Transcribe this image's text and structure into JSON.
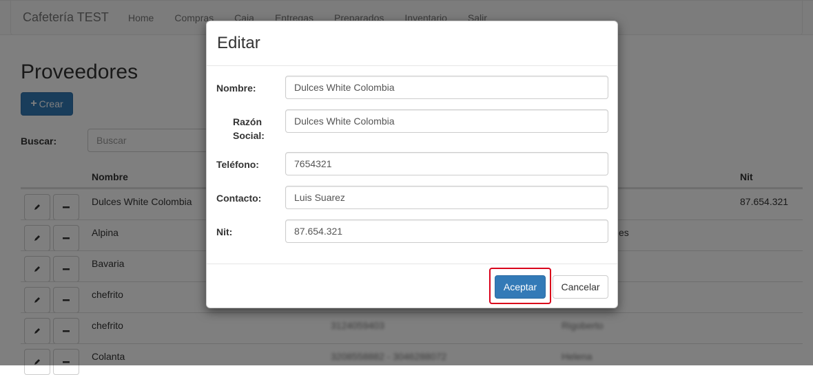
{
  "navbar": {
    "brand": "Cafetería TEST",
    "items": [
      {
        "label": "Home"
      },
      {
        "label": "Compras"
      },
      {
        "label": "Caja"
      },
      {
        "label": "Entregas"
      },
      {
        "label": "Preparados"
      },
      {
        "label": "Inventario"
      },
      {
        "label": "Salir"
      }
    ]
  },
  "page": {
    "title": "Proveedores",
    "create_button": "Crear",
    "search_label": "Buscar:",
    "search_placeholder": "Buscar"
  },
  "table": {
    "headers": {
      "nombre": "Nombre",
      "nit": "Nit"
    },
    "rows": [
      {
        "nombre": "Dulces White Colombia",
        "telefono": "",
        "contacto": "",
        "nit": "87.654.321"
      },
      {
        "nombre": "Alpina",
        "telefono": "",
        "contacto": "es",
        "nit": ""
      },
      {
        "nombre": "Bavaria",
        "telefono": "",
        "contacto": "",
        "nit": ""
      },
      {
        "nombre": "chefrito",
        "telefono": "",
        "contacto": "",
        "nit": ""
      },
      {
        "nombre": "chefrito",
        "telefono": "3124059403",
        "contacto": "Rigoberto",
        "nit": ""
      },
      {
        "nombre": "Colanta",
        "telefono": "3208558882 - 3046288072",
        "contacto": "Helena",
        "nit": ""
      }
    ]
  },
  "modal": {
    "title": "Editar",
    "fields": {
      "nombre": {
        "label": "Nombre:",
        "value": "Dulces White Colombia"
      },
      "razon_social": {
        "label_1": "Razón",
        "label_2": "Social:",
        "value": "Dulces White Colombia"
      },
      "telefono": {
        "label": "Teléfono:",
        "value": "7654321"
      },
      "contacto": {
        "label": "Contacto:",
        "value": "Luis Suarez"
      },
      "nit": {
        "label": "Nit:",
        "value": "87.654.321"
      }
    },
    "accept_button": "Aceptar",
    "cancel_button": "Cancelar"
  },
  "colors": {
    "primary": "#337ab7",
    "highlight": "#d9001b"
  }
}
